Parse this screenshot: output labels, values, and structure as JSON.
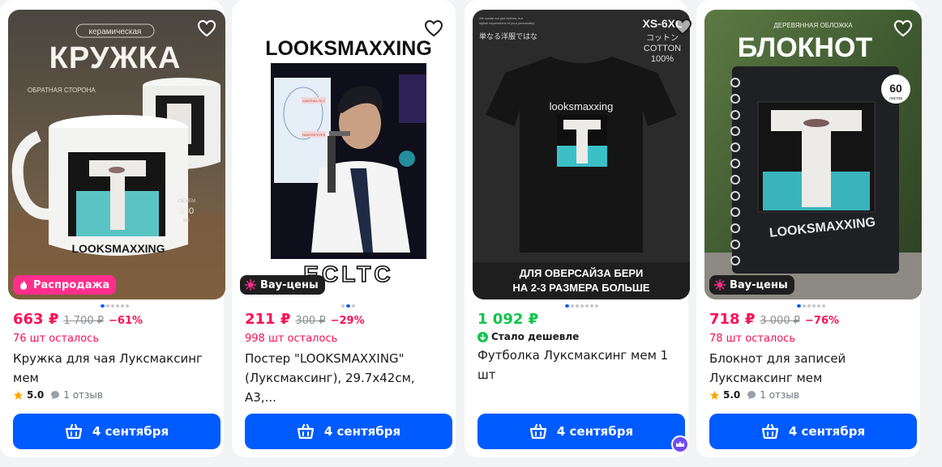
{
  "products": [
    {
      "badge": "Распродажа",
      "badge_type": "sale",
      "image_text": {
        "line1": "керамическая",
        "line2": "КРУЖКА",
        "line3": "ОБРАТНАЯ СТОРОНА",
        "brand": "LOOKSMAXXING",
        "volume": "ОБЪЕМ",
        "volume_value": "330",
        "volume_unit": "мл"
      },
      "price": "663 ₽",
      "old_price": "1 700 ₽",
      "discount": "−61%",
      "stock": "76 шт осталось",
      "title_line1": "Кружка для чая Луксмаксинг",
      "title_line2": "мем",
      "rating": "5.0",
      "reviews": "1 отзыв",
      "delivery": "4 сентября",
      "gallery_count": 6,
      "gallery_active": 0
    },
    {
      "badge": "Вау-цены",
      "badge_type": "wow",
      "image_text": {
        "headline": "LOOKSMAXXING",
        "tag1": "CANTHAL TILT",
        "tag2": "HUNTER EYES",
        "bottom": "ECLTC"
      },
      "price": "211 ₽",
      "old_price": "300 ₽",
      "discount": "−29%",
      "stock": "998 шт осталось",
      "title_line1": "Постер \"LOOKSMAXXING\"",
      "title_line2": "(Луксмаксинг), 29.7x42см, А3,...",
      "delivery": "4 сентября",
      "gallery_count": 3,
      "gallery_active": 1
    },
    {
      "image_text": {
        "sizes": "XS-6XL",
        "jp": "コットン",
        "cotton": "COTTON",
        "cotton_pct": "100%",
        "jp2": "単なる洋服ではな",
        "brand": "looksmaxxing",
        "oversize1": "ДЛЯ ОВЕРСАЙЗА БЕРИ",
        "oversize2": "НА 2-3 РАЗМЕРА БОЛЬШЕ",
        "tiny1": "We create not just clothes, but",
        "tiny2": "stylish expressions of your personality!"
      },
      "price": "1 092 ₽",
      "cheaper_label": "Стало дешевле",
      "title_line1": "Футболка Луксмаксинг мем 1 шт",
      "delivery": "4 сентября",
      "gallery_count": 7,
      "gallery_active": 0
    },
    {
      "badge": "Вау-цены",
      "badge_type": "wow",
      "image_text": {
        "top": "ДЕРЕВЯННАЯ ОБЛОЖКА",
        "headline": "БЛОКНОТ",
        "sheets": "60",
        "sheets_label": "листов",
        "brand": "LOOKSMAXXING"
      },
      "price": "718 ₽",
      "old_price": "3 000 ₽",
      "discount": "−76%",
      "stock": "78 шт осталось",
      "title_line1": "Блокнот для записей",
      "title_line2": "Луксмаксинг мем",
      "rating": "5.0",
      "reviews": "1 отзыв",
      "delivery": "4 сентября",
      "gallery_count": 6,
      "gallery_active": 0
    }
  ],
  "colors": {
    "accent": "#005bff",
    "price": "#f91155",
    "green": "#10c44c",
    "sale": "#ff2e8c"
  },
  "icons": {
    "favorite": "heart-icon",
    "cart": "basket-icon",
    "sale": "flame-icon",
    "wow": "sparkle-icon",
    "rating": "star-icon",
    "reviews": "chat-bubble-icon",
    "cheaper": "arrow-down-icon",
    "floating": "crown-icon"
  }
}
